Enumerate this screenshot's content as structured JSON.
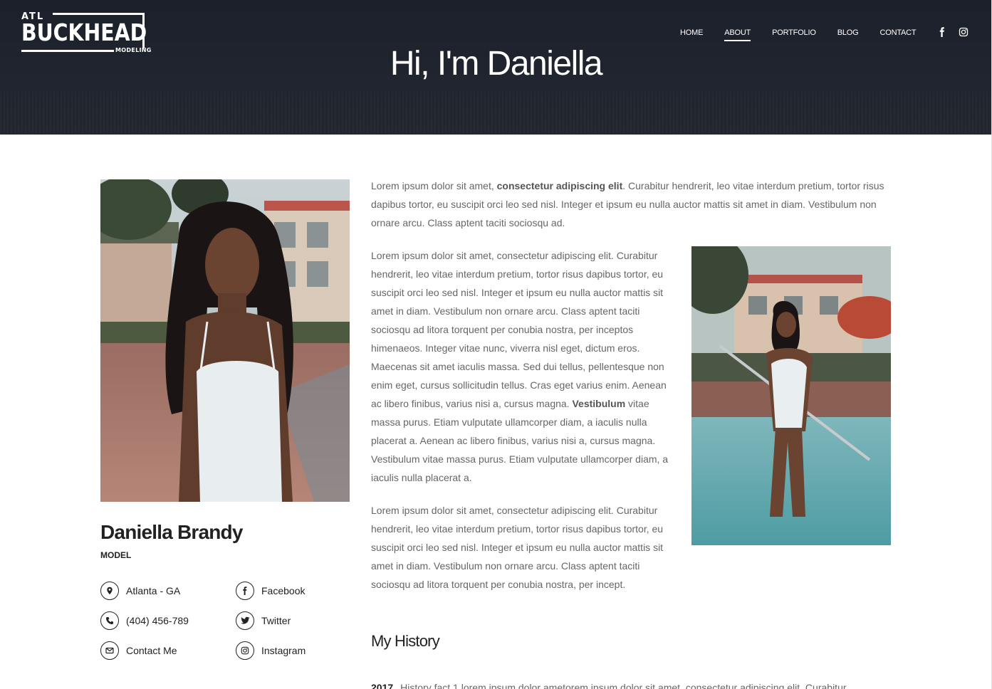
{
  "brand": {
    "logo_top": "ATL",
    "logo_name": "BUCKHEAD",
    "logo_sub": "MODELING"
  },
  "nav": {
    "items": [
      "HOME",
      "ABOUT",
      "PORTFOLIO",
      "BLOG",
      "CONTACT"
    ],
    "active": "ABOUT",
    "social_icons": [
      "facebook-icon",
      "instagram-icon"
    ]
  },
  "hero": {
    "title": "Hi, I'm Daniella"
  },
  "profile": {
    "name": "Daniella Brandy",
    "role": "MODEL",
    "contact": [
      {
        "icon": "map-pin-icon",
        "label": "Atlanta - GA"
      },
      {
        "icon": "phone-icon",
        "label": "(404) 456-789"
      },
      {
        "icon": "envelope-icon",
        "label": "Contact Me"
      }
    ],
    "social": [
      {
        "icon": "facebook-icon",
        "label": "Facebook"
      },
      {
        "icon": "twitter-icon",
        "label": "Twitter"
      },
      {
        "icon": "instagram-icon",
        "label": "Instagram"
      }
    ]
  },
  "content": {
    "p1_a": "Lorem ipsum dolor sit amet, ",
    "p1_bold": "consectetur adipiscing elit",
    "p1_b": ". Curabitur hendrerit, leo vitae interdum pretium, tortor risus dapibus tortor, eu suscipit orci leo sed nisl. Integer et ipsum eu nulla auctor mattis sit amet in diam. Vestibulum non ornare arcu. Class aptent taciti sociosqu ad.",
    "p2_a": "Lorem ipsum dolor sit amet, consectetur adipiscing elit. Curabitur hendrerit, leo vitae interdum pretium, tortor risus dapibus tortor, eu suscipit orci leo sed nisl. Integer et ipsum eu nulla auctor mattis sit amet in diam. Vestibulum non ornare arcu. Class aptent taciti sociosqu ad litora torquent per conubia nostra, per inceptos himenaeos. Integer vitae nunc, viverra nisl eget, dictum eros. Maecenas sit amet iaculis massa. Sed dui tellus, pellentesque non enim eget, cursus sollicitudin tellus. Cras eget varius enim. Aenean ac libero finibus, varius nisi a, cursus magna. ",
    "p2_bold": "Vestibulum",
    "p2_b": " vitae massa purus. Etiam vulputate ullamcorper diam, a iaculis nulla placerat a. Aenean ac libero finibus, varius nisi a, cursus magna. Vestibulum vitae massa purus. Etiam vulputate ullamcorper diam, a iaculis nulla placerat a.",
    "p3": "Lorem ipsum dolor sit amet, consectetur adipiscing elit. Curabitur hendrerit, leo vitae interdum pretium, tortor risus dapibus tortor, eu suscipit orci leo sed nisl. Integer et ipsum eu nulla auctor mattis sit amet in diam. Vestibulum non ornare arcu. Class aptent taciti sociosqu ad litora torquent per conubia nostra, per incept."
  },
  "history": {
    "title": "My History",
    "first_year": "2017",
    "first_text": "History fact 1 lorem ipsum dolor ametorem ipsum dolor sit amet, consectetur adipiscing elit. Curabitur"
  },
  "colors": {
    "header_bg": "#1e232d",
    "text_dark": "#222222",
    "text_body": "#666666"
  }
}
